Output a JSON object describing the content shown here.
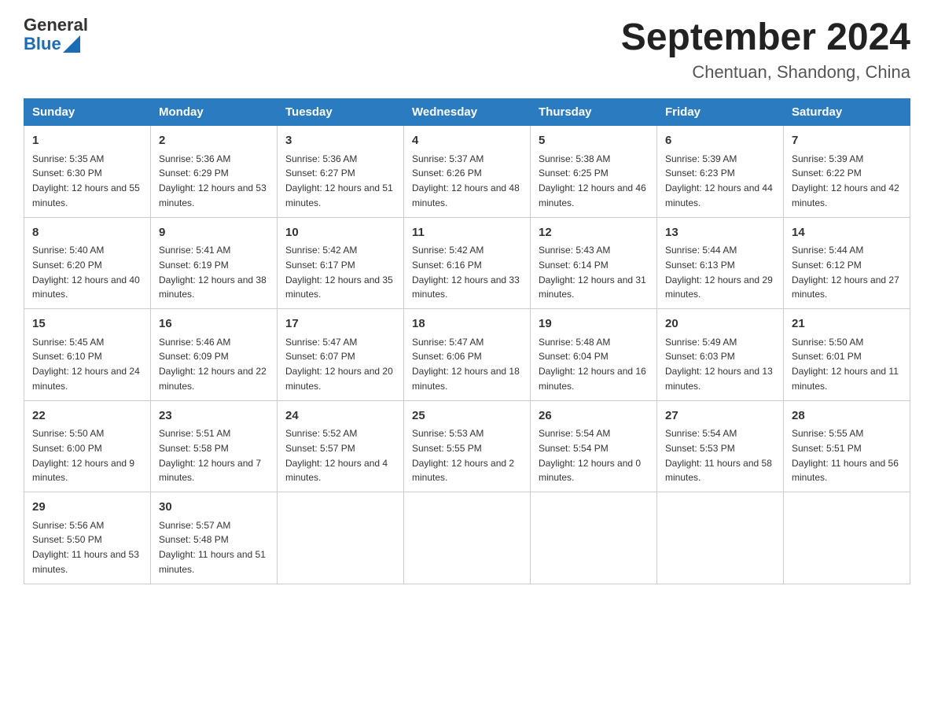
{
  "logo": {
    "general": "General",
    "blue": "Blue"
  },
  "title": "September 2024",
  "subtitle": "Chentuan, Shandong, China",
  "headers": [
    "Sunday",
    "Monday",
    "Tuesday",
    "Wednesday",
    "Thursday",
    "Friday",
    "Saturday"
  ],
  "weeks": [
    [
      {
        "day": "1",
        "sunrise": "5:35 AM",
        "sunset": "6:30 PM",
        "daylight": "12 hours and 55 minutes."
      },
      {
        "day": "2",
        "sunrise": "5:36 AM",
        "sunset": "6:29 PM",
        "daylight": "12 hours and 53 minutes."
      },
      {
        "day": "3",
        "sunrise": "5:36 AM",
        "sunset": "6:27 PM",
        "daylight": "12 hours and 51 minutes."
      },
      {
        "day": "4",
        "sunrise": "5:37 AM",
        "sunset": "6:26 PM",
        "daylight": "12 hours and 48 minutes."
      },
      {
        "day": "5",
        "sunrise": "5:38 AM",
        "sunset": "6:25 PM",
        "daylight": "12 hours and 46 minutes."
      },
      {
        "day": "6",
        "sunrise": "5:39 AM",
        "sunset": "6:23 PM",
        "daylight": "12 hours and 44 minutes."
      },
      {
        "day": "7",
        "sunrise": "5:39 AM",
        "sunset": "6:22 PM",
        "daylight": "12 hours and 42 minutes."
      }
    ],
    [
      {
        "day": "8",
        "sunrise": "5:40 AM",
        "sunset": "6:20 PM",
        "daylight": "12 hours and 40 minutes."
      },
      {
        "day": "9",
        "sunrise": "5:41 AM",
        "sunset": "6:19 PM",
        "daylight": "12 hours and 38 minutes."
      },
      {
        "day": "10",
        "sunrise": "5:42 AM",
        "sunset": "6:17 PM",
        "daylight": "12 hours and 35 minutes."
      },
      {
        "day": "11",
        "sunrise": "5:42 AM",
        "sunset": "6:16 PM",
        "daylight": "12 hours and 33 minutes."
      },
      {
        "day": "12",
        "sunrise": "5:43 AM",
        "sunset": "6:14 PM",
        "daylight": "12 hours and 31 minutes."
      },
      {
        "day": "13",
        "sunrise": "5:44 AM",
        "sunset": "6:13 PM",
        "daylight": "12 hours and 29 minutes."
      },
      {
        "day": "14",
        "sunrise": "5:44 AM",
        "sunset": "6:12 PM",
        "daylight": "12 hours and 27 minutes."
      }
    ],
    [
      {
        "day": "15",
        "sunrise": "5:45 AM",
        "sunset": "6:10 PM",
        "daylight": "12 hours and 24 minutes."
      },
      {
        "day": "16",
        "sunrise": "5:46 AM",
        "sunset": "6:09 PM",
        "daylight": "12 hours and 22 minutes."
      },
      {
        "day": "17",
        "sunrise": "5:47 AM",
        "sunset": "6:07 PM",
        "daylight": "12 hours and 20 minutes."
      },
      {
        "day": "18",
        "sunrise": "5:47 AM",
        "sunset": "6:06 PM",
        "daylight": "12 hours and 18 minutes."
      },
      {
        "day": "19",
        "sunrise": "5:48 AM",
        "sunset": "6:04 PM",
        "daylight": "12 hours and 16 minutes."
      },
      {
        "day": "20",
        "sunrise": "5:49 AM",
        "sunset": "6:03 PM",
        "daylight": "12 hours and 13 minutes."
      },
      {
        "day": "21",
        "sunrise": "5:50 AM",
        "sunset": "6:01 PM",
        "daylight": "12 hours and 11 minutes."
      }
    ],
    [
      {
        "day": "22",
        "sunrise": "5:50 AM",
        "sunset": "6:00 PM",
        "daylight": "12 hours and 9 minutes."
      },
      {
        "day": "23",
        "sunrise": "5:51 AM",
        "sunset": "5:58 PM",
        "daylight": "12 hours and 7 minutes."
      },
      {
        "day": "24",
        "sunrise": "5:52 AM",
        "sunset": "5:57 PM",
        "daylight": "12 hours and 4 minutes."
      },
      {
        "day": "25",
        "sunrise": "5:53 AM",
        "sunset": "5:55 PM",
        "daylight": "12 hours and 2 minutes."
      },
      {
        "day": "26",
        "sunrise": "5:54 AM",
        "sunset": "5:54 PM",
        "daylight": "12 hours and 0 minutes."
      },
      {
        "day": "27",
        "sunrise": "5:54 AM",
        "sunset": "5:53 PM",
        "daylight": "11 hours and 58 minutes."
      },
      {
        "day": "28",
        "sunrise": "5:55 AM",
        "sunset": "5:51 PM",
        "daylight": "11 hours and 56 minutes."
      }
    ],
    [
      {
        "day": "29",
        "sunrise": "5:56 AM",
        "sunset": "5:50 PM",
        "daylight": "11 hours and 53 minutes."
      },
      {
        "day": "30",
        "sunrise": "5:57 AM",
        "sunset": "5:48 PM",
        "daylight": "11 hours and 51 minutes."
      },
      null,
      null,
      null,
      null,
      null
    ]
  ]
}
